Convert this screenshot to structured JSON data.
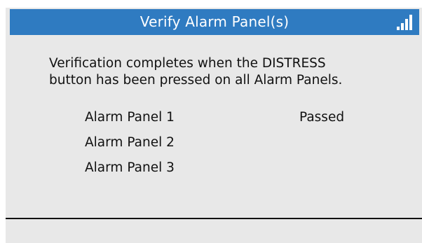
{
  "title_bar": {
    "title": "Verify Alarm Panel(s)",
    "signal_icon": "signal-strength-icon",
    "color": "#2f7bc1"
  },
  "message": {
    "line1": "Verification completes when the DISTRESS",
    "line2": "button has been pressed on all Alarm Panels."
  },
  "panels": [
    {
      "label": "Alarm Panel 1",
      "status": "Passed"
    },
    {
      "label": "Alarm Panel 2",
      "status": ""
    },
    {
      "label": "Alarm Panel 3",
      "status": ""
    }
  ]
}
